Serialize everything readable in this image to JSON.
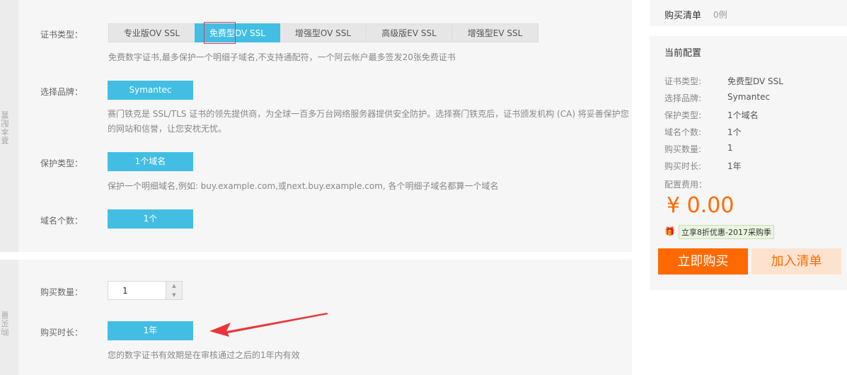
{
  "basic": {
    "section_label": "基本配置",
    "cert_type": {
      "label": "证书类型：",
      "options": [
        "专业版OV SSL",
        "免费型DV SSL",
        "增强型OV SSL",
        "高级版EV SSL",
        "增强型EV SSL"
      ],
      "selected": "免费型DV SSL",
      "desc": "免费数字证书,最多保护一个明细子域名,不支持通配符，一个阿云帐户最多签发20张免费证书"
    },
    "brand": {
      "label": "选择品牌：",
      "value": "Symantec",
      "desc_line1": "赛门铁克是 SSL/TLS 证书的领先提供商，为全球一百多万台网络服务器提供安全防护。选择赛门铁克后，证书颁发机构 (CA) 将妥善保护您",
      "desc_line2": "的网站和信誉，让您安枕无忧。"
    },
    "protect": {
      "label": "保护类型：",
      "value": "1个域名",
      "desc": "保护一个明细域名,例如: buy.example.com,或next.buy.example.com, 各个明细子域名都算一个域名"
    },
    "domains": {
      "label": "域名个数：",
      "value": "1个"
    }
  },
  "purchase": {
    "section_label": "购买量",
    "qty": {
      "label": "购买数量：",
      "value": "1"
    },
    "duration": {
      "label": "购买时长：",
      "value": "1年",
      "desc": "您的数字证书有效期是在审核通过之后的1年内有效"
    }
  },
  "cart": {
    "title": "购买清单",
    "count": "0例"
  },
  "config": {
    "title": "当前配置",
    "items": [
      {
        "label": "证书类型:",
        "value": "免费型DV SSL"
      },
      {
        "label": "选择品牌:",
        "value": "Symantec"
      },
      {
        "label": "保护类型:",
        "value": "1个域名"
      },
      {
        "label": "域名个数:",
        "value": "1个"
      },
      {
        "label": "购买数量:",
        "value": "1"
      },
      {
        "label": "购买时长:",
        "value": "1年"
      }
    ],
    "fee_label": "配置费用：",
    "price": "¥ 0.00",
    "promo": "立享8折优惠-2017采购季",
    "buy_label": "立即购买",
    "add_label": "加入清单"
  },
  "colors": {
    "accent": "#43bee3",
    "orange": "#ff6a00",
    "highlight": "#e6354d",
    "arrow": "#e8363b"
  }
}
